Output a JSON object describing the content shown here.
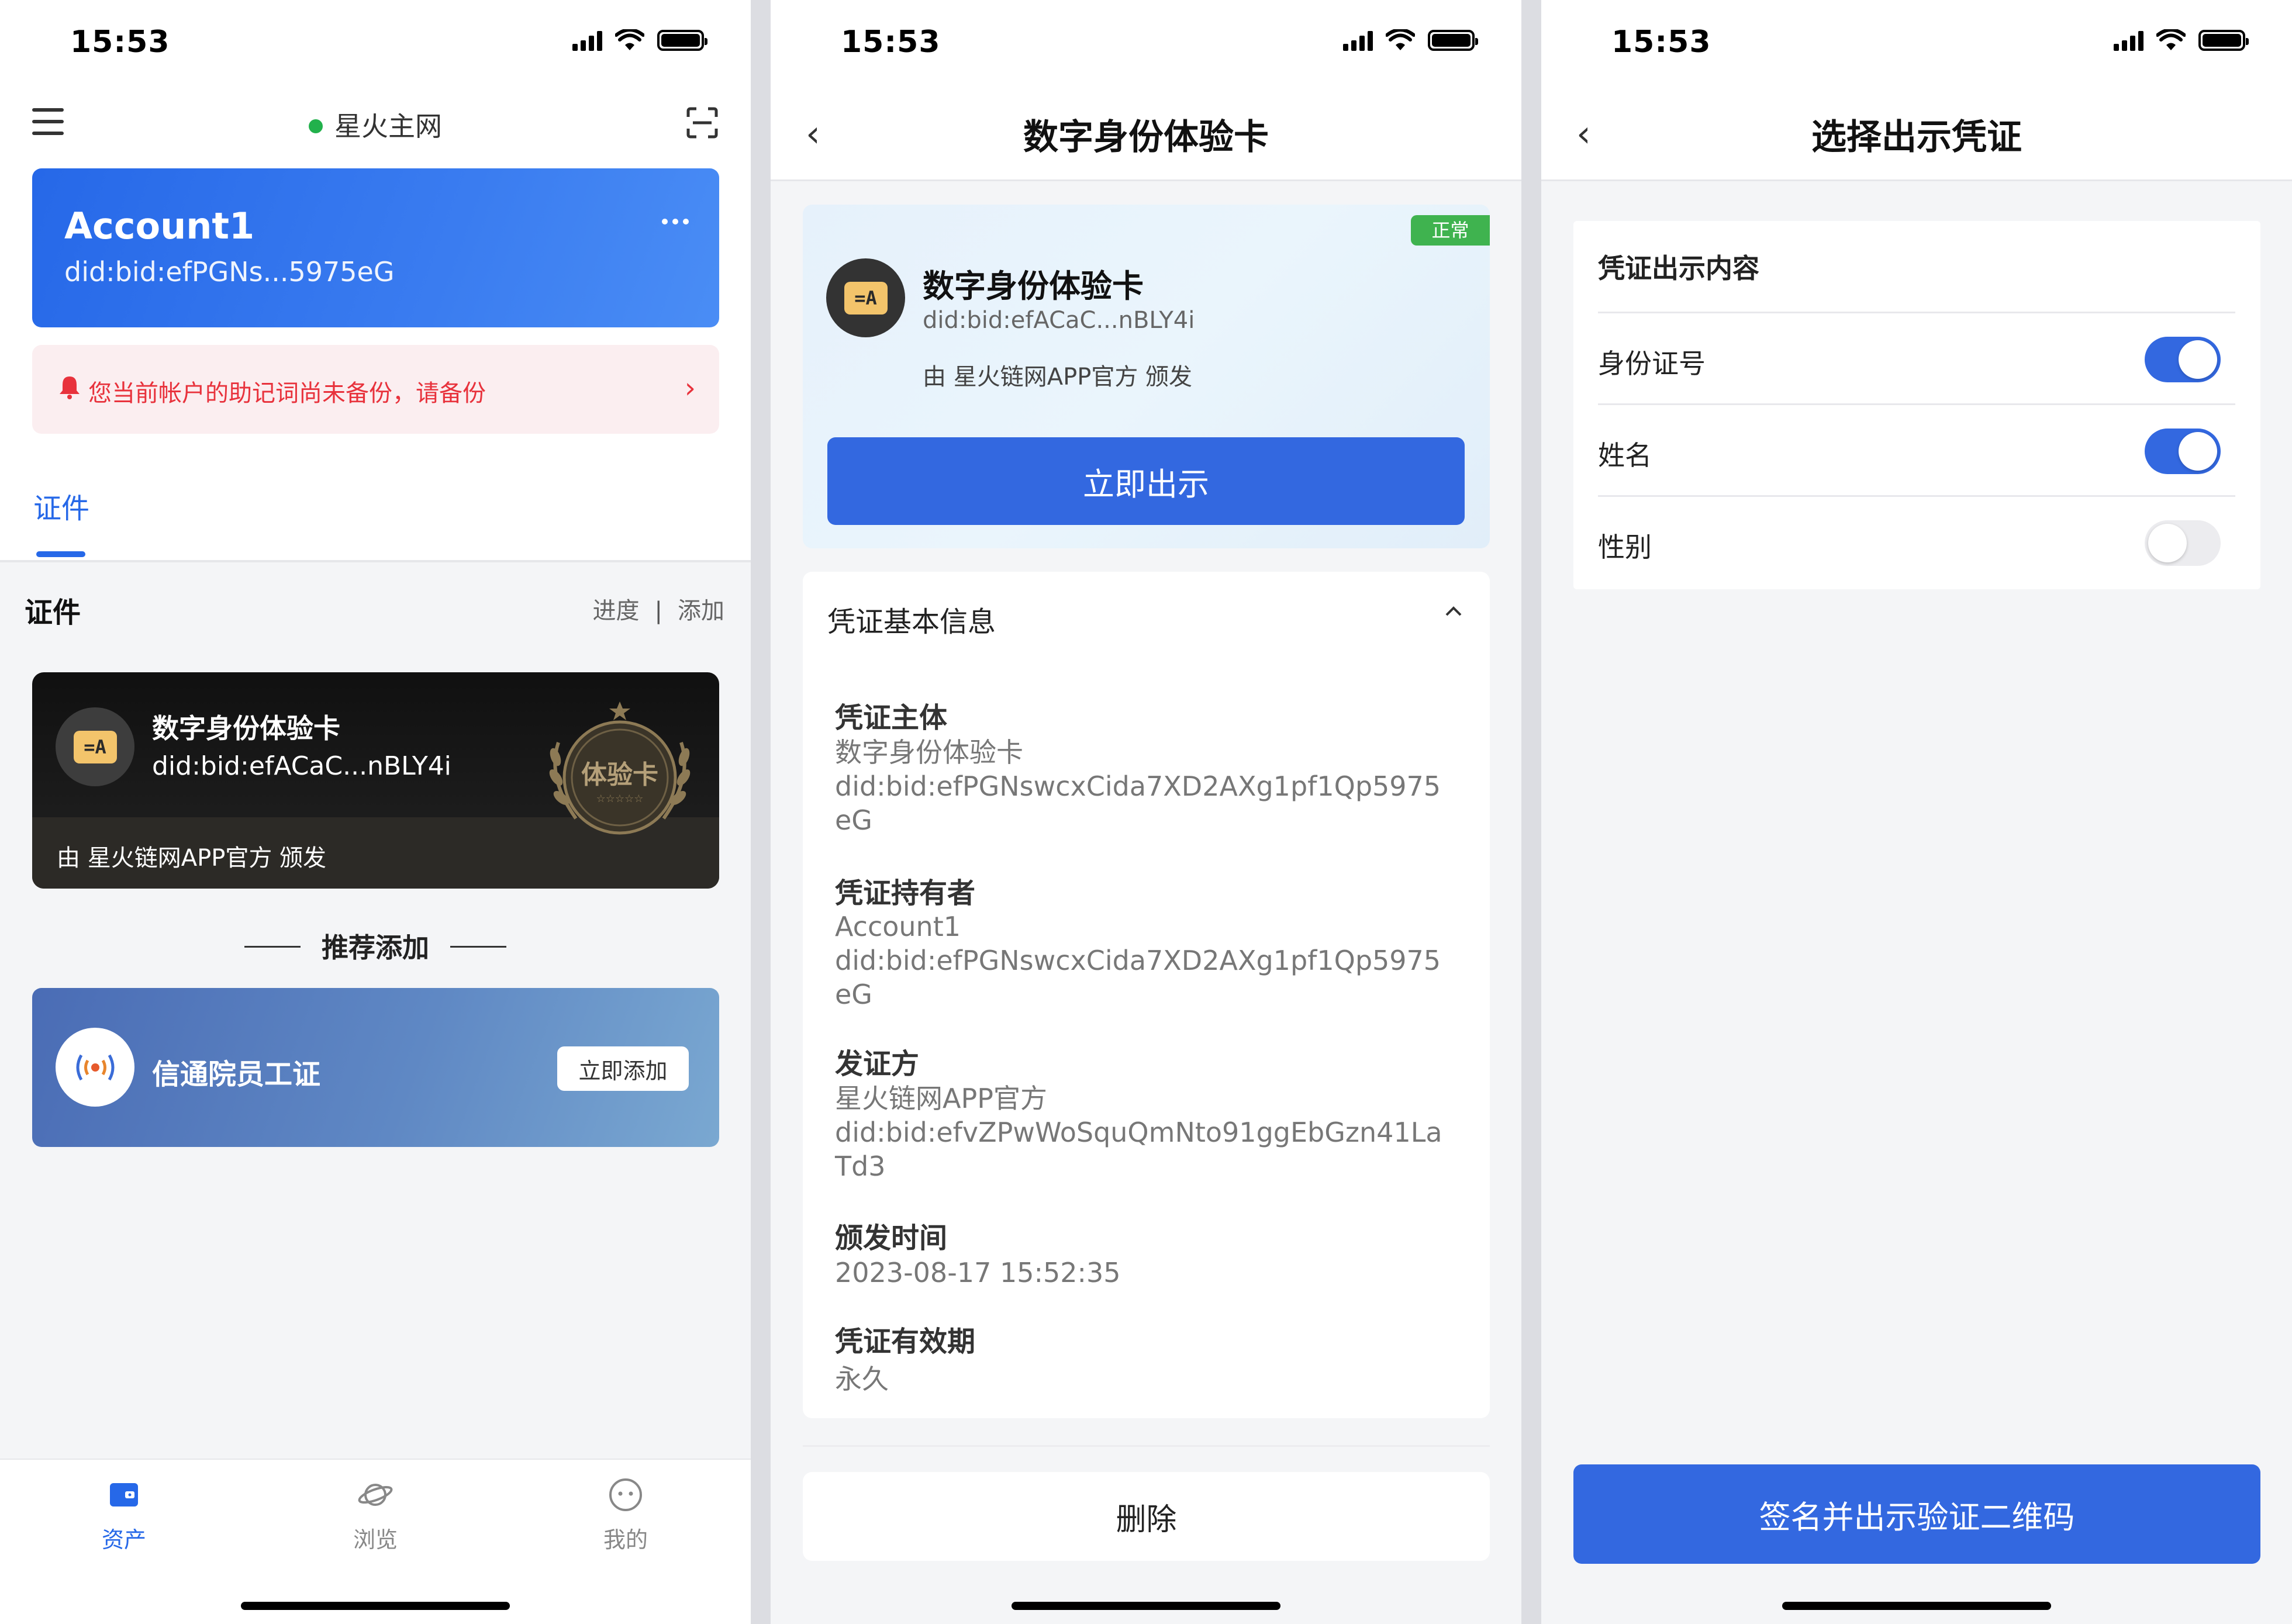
{
  "status_bar": {
    "time": "15:53"
  },
  "screen1": {
    "network": "星火主网",
    "account": {
      "name": "Account1",
      "did": "did:bid:efPGNs...5975eG"
    },
    "warning": "您当前帐户的助记词尚未备份，请备份",
    "tab": "证件",
    "section_title": "证件",
    "links": {
      "progress": "进度",
      "separator": "|",
      "add": "添加"
    },
    "credential": {
      "title": "数字身份体验卡",
      "did": "did:bid:efACaC...nBLY4i",
      "issuer": "由 星火链网APP官方 颁发",
      "medal_text": "体验卡"
    },
    "recommend_title": "推荐添加",
    "recommend": {
      "name": "信通院员工证",
      "button": "立即添加"
    },
    "tabbar": [
      {
        "label": "资产",
        "icon": "wallet-icon",
        "active": true
      },
      {
        "label": "浏览",
        "icon": "planet-icon",
        "active": false
      },
      {
        "label": "我的",
        "icon": "smile-icon",
        "active": false
      }
    ]
  },
  "screen2": {
    "title": "数字身份体验卡",
    "card": {
      "status": "正常",
      "title": "数字身份体验卡",
      "did": "did:bid:efACaC...nBLY4i",
      "issuer": "由 星火链网APP官方 颁发",
      "button": "立即出示"
    },
    "info_title": "凭证基本信息",
    "fields": [
      {
        "label": "凭证主体",
        "value": "数字身份体验卡",
        "value2": "did:bid:efPGNswcxCida7XD2AXg1pf1Qp5975eG"
      },
      {
        "label": "凭证持有者",
        "value": "Account1",
        "value2": "did:bid:efPGNswcxCida7XD2AXg1pf1Qp5975eG"
      },
      {
        "label": "发证方",
        "value": "星火链网APP官方",
        "value2": "did:bid:efvZPwWoSquQmNto91ggEbGzn41LaTd3"
      },
      {
        "label": "颁发时间",
        "value": "2023-08-17 15:52:35"
      },
      {
        "label": "凭证有效期",
        "value": "永久"
      }
    ],
    "delete_button": "删除"
  },
  "screen3": {
    "title": "选择出示凭证",
    "section_title": "凭证出示内容",
    "options": [
      {
        "label": "身份证号",
        "enabled": true
      },
      {
        "label": "姓名",
        "enabled": true
      },
      {
        "label": "性别",
        "enabled": false
      }
    ],
    "submit_button": "签名并出示验证二维码"
  },
  "colors": {
    "primary": "#3368e0",
    "accent_blue": "#2668e8",
    "warning_red": "#e8323c",
    "status_green": "#3fb34f"
  }
}
